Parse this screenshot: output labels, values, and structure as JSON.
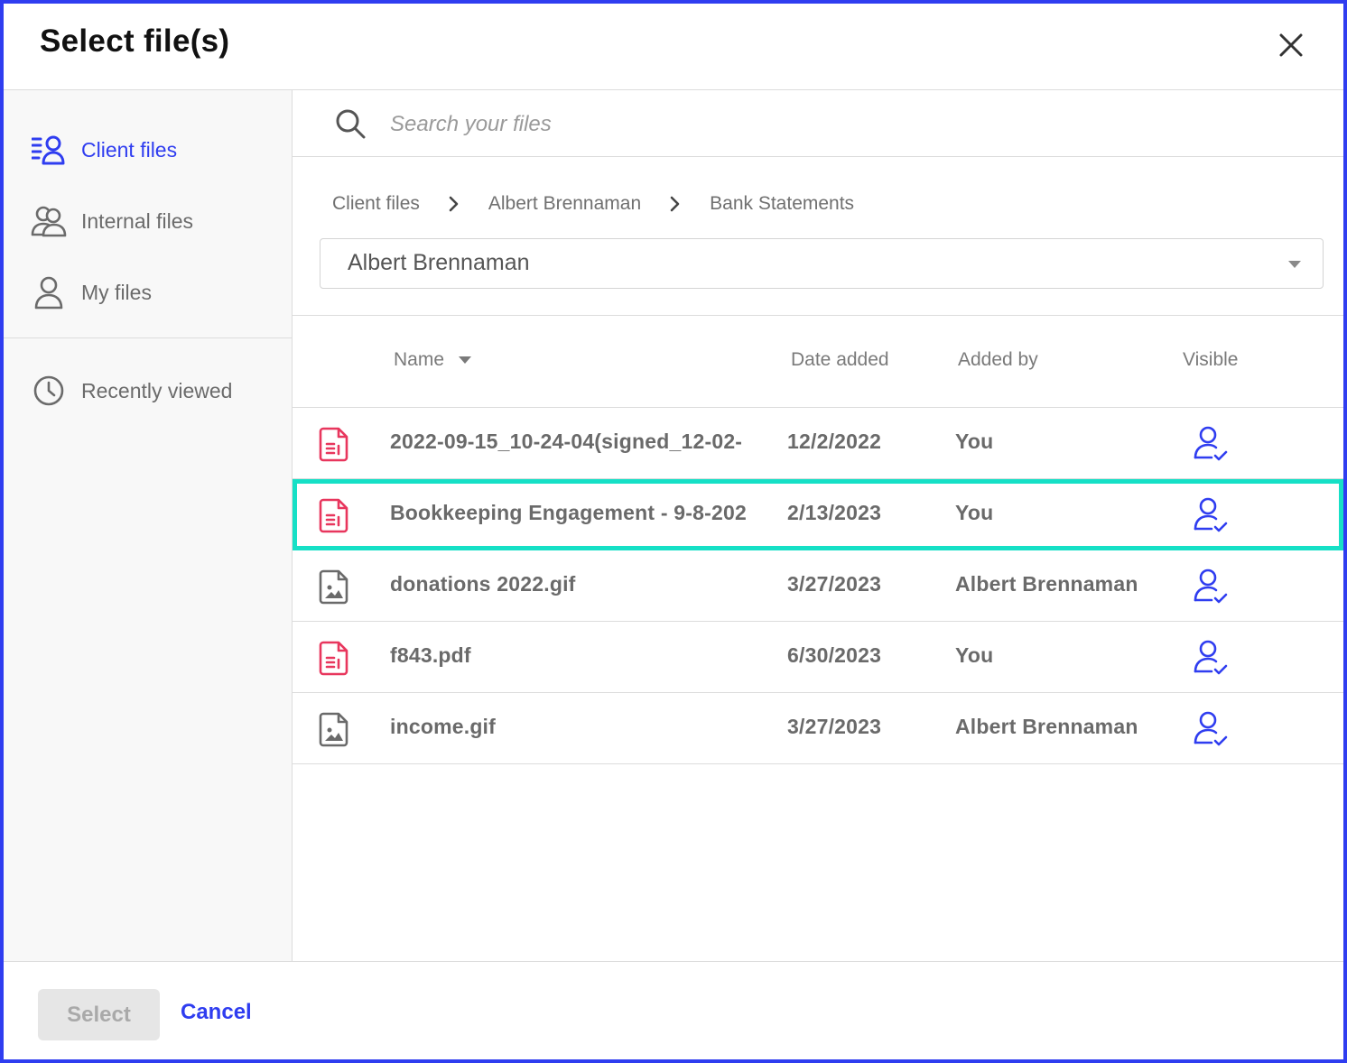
{
  "dialog": {
    "title": "Select file(s)",
    "close_icon": "close-icon"
  },
  "sidebar": {
    "items": [
      {
        "label": "Client files",
        "icon": "client-files-icon",
        "active": true
      },
      {
        "label": "Internal files",
        "icon": "users-icon",
        "active": false
      },
      {
        "label": "My files",
        "icon": "user-icon",
        "active": false
      },
      {
        "label": "Recently viewed",
        "icon": "clock-icon",
        "active": false
      }
    ]
  },
  "search": {
    "placeholder": "Search your files",
    "value": ""
  },
  "breadcrumb": [
    "Client files",
    "Albert Brennaman",
    "Bank Statements"
  ],
  "client_select": {
    "value": "Albert Brennaman"
  },
  "table": {
    "columns": [
      "Name",
      "Date added",
      "Added by",
      "Visible"
    ],
    "rows": [
      {
        "name": "2022-09-15_10-24-04(signed_12-02-",
        "date": "12/2/2022",
        "added_by": "You",
        "type": "document",
        "visible": true
      },
      {
        "name": "Bookkeeping Engagement - 9-8-202",
        "date": "2/13/2023",
        "added_by": "You",
        "type": "document",
        "visible": true,
        "selected": true
      },
      {
        "name": "donations 2022.gif",
        "date": "3/27/2023",
        "added_by": "Albert Brennaman",
        "type": "image",
        "visible": true
      },
      {
        "name": "f843.pdf",
        "date": "6/30/2023",
        "added_by": "You",
        "type": "document",
        "visible": true
      },
      {
        "name": "income.gif",
        "date": "3/27/2023",
        "added_by": "Albert Brennaman",
        "type": "image",
        "visible": true
      }
    ]
  },
  "footer": {
    "select_label": "Select",
    "cancel_label": "Cancel"
  },
  "colors": {
    "accent": "#2f3df0",
    "highlight": "#16e0c6",
    "doc_icon": "#e8365d",
    "image_icon": "#6a6a6a"
  }
}
